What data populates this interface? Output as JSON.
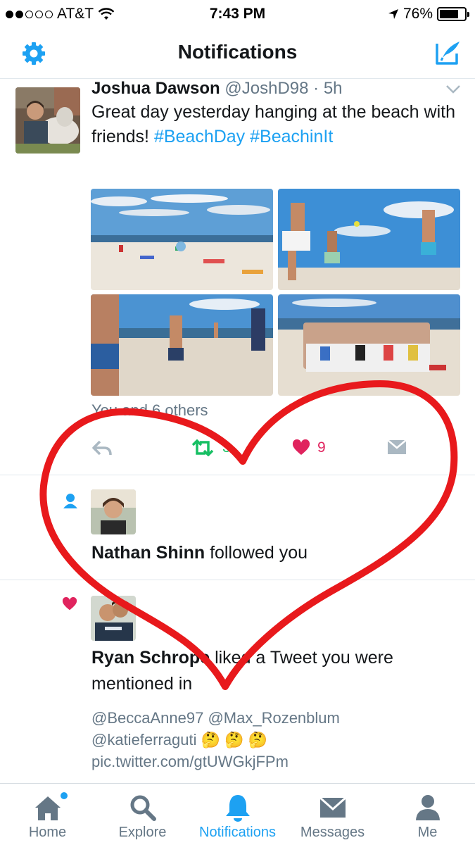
{
  "status_bar": {
    "carrier": "AT&T",
    "time": "7:43 PM",
    "battery": "76%",
    "battery_level": 0.76
  },
  "nav": {
    "title": "Notifications",
    "settings_icon": "gear-icon",
    "compose_icon": "compose-icon"
  },
  "tweet": {
    "author_name": "Joshua Dawson",
    "author_handle": "@JoshD98",
    "time_ago": "5h",
    "text": "Great day yesterday hanging at the beach with friends!",
    "hashtag1": "#BeachDay",
    "hashtag2": "#BeachinIt",
    "likers": "You and 6 others",
    "retweets": "3",
    "likes": "9"
  },
  "notifications": [
    {
      "type": "follow",
      "name": "Nathan Shinn",
      "action": "followed you"
    },
    {
      "type": "like",
      "name": "Ryan Schrope",
      "action": "liked a Tweet you were mentioned in",
      "mentions": "@BeccaAnne97 @Max_Rozenblum @katieferraguti",
      "emoji": "🤔 🤔 🤔",
      "link": "pic.twitter.com/gtUWGkjFPm"
    }
  ],
  "tabs": [
    {
      "label": "Home",
      "icon": "home-icon"
    },
    {
      "label": "Explore",
      "icon": "search-icon"
    },
    {
      "label": "Notifications",
      "icon": "bell-icon"
    },
    {
      "label": "Messages",
      "icon": "envelope-icon"
    },
    {
      "label": "Me",
      "icon": "person-icon"
    }
  ],
  "colors": {
    "accent": "#1da1f2",
    "like": "#e0245e",
    "retweet": "#17bf63",
    "overlay_heart": "#e8191c"
  }
}
